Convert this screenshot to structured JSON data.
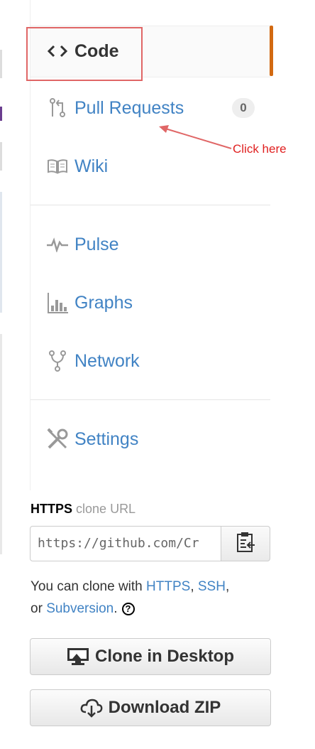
{
  "nav": {
    "items": [
      {
        "label": "Code",
        "icon": "code-icon"
      },
      {
        "label": "Pull Requests",
        "icon": "pull-request-icon",
        "count": "0"
      },
      {
        "label": "Wiki",
        "icon": "book-icon"
      },
      {
        "label": "Pulse",
        "icon": "pulse-icon"
      },
      {
        "label": "Graphs",
        "icon": "graph-icon"
      },
      {
        "label": "Network",
        "icon": "fork-icon"
      },
      {
        "label": "Settings",
        "icon": "tools-icon"
      }
    ],
    "selected_index": 0
  },
  "annotation": {
    "text": "Click here",
    "color": "#e02020",
    "box_color": "#e06666"
  },
  "clone": {
    "protocol": "HTTPS",
    "title_suffix": "clone URL",
    "url": "https://github.com/Cr",
    "help_prefix": "You can clone with ",
    "link_https": "HTTPS",
    "comma": ", ",
    "link_ssh": "SSH",
    "help_middle": ",",
    "help_or": "or ",
    "link_subversion": "Subversion",
    "help_end": ".",
    "help_icon": "?"
  },
  "buttons": {
    "clone_desktop": "Clone in Desktop",
    "download_zip": "Download ZIP"
  },
  "colors": {
    "link": "#4183c4",
    "selected_bar": "#d26911"
  }
}
